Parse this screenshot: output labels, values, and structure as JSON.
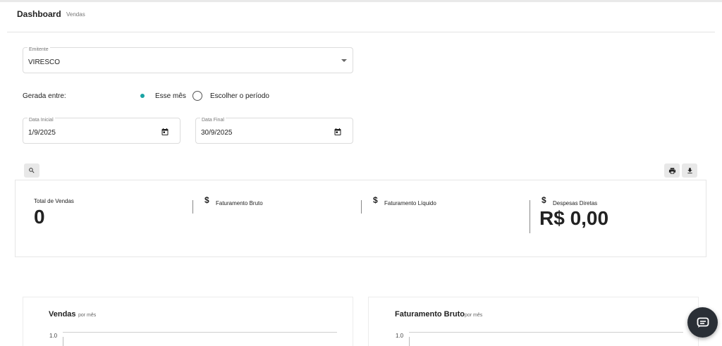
{
  "header": {
    "title": "Dashboard",
    "subtitle": "Vendas"
  },
  "emitente": {
    "label": "Emitente",
    "value": "VIRESCO"
  },
  "periodo": {
    "label": "Gerada entre:",
    "options": [
      {
        "label": "Esse mês",
        "selected": true
      },
      {
        "label": "Escolher o período",
        "selected": false
      }
    ]
  },
  "datas": {
    "inicial": {
      "label": "Data Inicial",
      "value": "1/9/2025"
    },
    "final": {
      "label": "Data Final",
      "value": "30/9/2025"
    }
  },
  "toolbar": {
    "search_icon": "search-icon",
    "print_icon": "print-icon",
    "download_icon": "download-icon"
  },
  "kpis": {
    "total_vendas": {
      "label": "Total de Vendas",
      "value": "0"
    },
    "faturamento_bruto": {
      "label": "Faturamento Bruto",
      "currency_symbol": "$"
    },
    "faturamento_liquido": {
      "label": "Faturamento Líquido",
      "currency_symbol": "$"
    },
    "despesas_diretas": {
      "label": "Despesas Diretas",
      "currency_symbol": "$",
      "value": "R$ 0,00"
    }
  },
  "charts": [
    {
      "title": "Vendas",
      "subtitle": "por mês",
      "y_tick": "1.0"
    },
    {
      "title": "Faturamento Bruto",
      "subtitle": "por mês",
      "y_tick": "1.0"
    }
  ],
  "colors": {
    "accent": "#1aa3a3",
    "chat_button": "#2a2f36"
  }
}
